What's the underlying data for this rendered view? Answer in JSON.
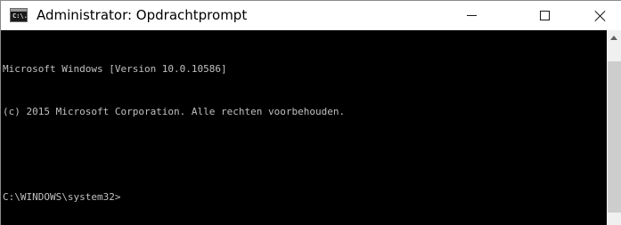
{
  "window": {
    "title": "Administrator: Opdrachtprompt",
    "icon": "cmd-icon",
    "icon_label": "C:\\."
  },
  "caption_buttons": {
    "minimize": "minimize-icon",
    "maximize": "maximize-icon",
    "close": "close-icon"
  },
  "console": {
    "lines": [
      "Microsoft Windows [Version 10.0.10586]",
      "(c) 2015 Microsoft Corporation. Alle rechten voorbehouden.",
      "",
      "C:\\WINDOWS\\system32>"
    ],
    "background": "#000000",
    "foreground": "#c0c0c0"
  },
  "scrollbar": {
    "up_arrow": "chevron-up-icon"
  }
}
